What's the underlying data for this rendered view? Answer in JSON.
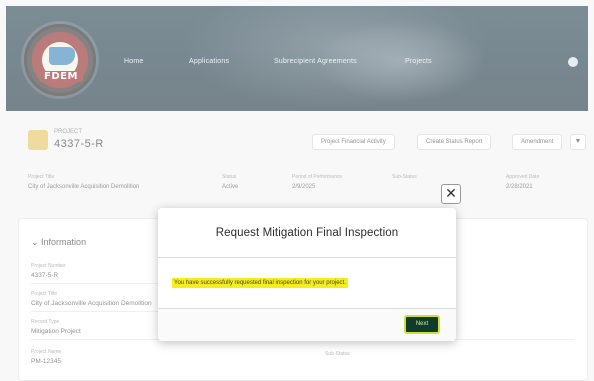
{
  "header": {
    "logo_text": "FDEM",
    "nav": [
      "Home",
      "Applications",
      "Subrecipient Agreements",
      "Projects"
    ]
  },
  "record": {
    "type_label": "PROJECT",
    "id": "4337-5-R",
    "buttons": [
      "Project Financial Activity",
      "Create Status Report",
      "Amendment"
    ],
    "caret": "▼"
  },
  "highlights": [
    {
      "label": "Project Title",
      "value": "City of Jacksonville Acquisition Demolition"
    },
    {
      "label": "Status",
      "value": "Active"
    },
    {
      "label": "Period of Performance",
      "value": "2/9/2025"
    },
    {
      "label": "Sub-Status",
      "value": ""
    },
    {
      "label": "Approved Date",
      "value": "2/28/2021"
    }
  ],
  "details": {
    "section_title": "Information",
    "fields": [
      {
        "label": "Project Number",
        "value": "4337-5-R"
      },
      {
        "label": "Project Title",
        "value": "City of Jacksonville Acquisition Demolition"
      },
      {
        "label": "Record Type",
        "value": "Mitigation Project"
      },
      {
        "label": "Project Name",
        "value": "PM-12345"
      }
    ],
    "right_label": "Sub-Status"
  },
  "modal": {
    "title": "Request Mitigation Final Inspection",
    "message": "You have successfully requested final inspection for your project.",
    "next_label": "Next",
    "close_glyph": "✕"
  }
}
